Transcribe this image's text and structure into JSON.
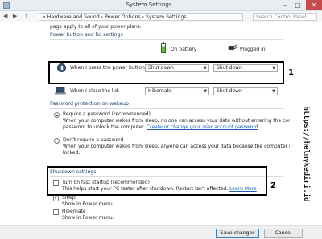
{
  "window": {
    "title": "System Settings",
    "minimize": "–",
    "maximize": "□",
    "close": "✕"
  },
  "address": {
    "back": "◀",
    "forward": "▶",
    "up": "↑",
    "crumbs": "« Hardware and Sound  ›  Power Options  ›  System Settings",
    "search_placeholder": "Search Control Panel"
  },
  "intro_text": "page apply to all of your power plans.",
  "power_lid": {
    "heading": "Power button and lid settings",
    "col_battery": "On battery",
    "col_plugged": "Plugged in",
    "power_button": {
      "label": "When I press the power button:",
      "on_battery": "Shut down",
      "plugged_in": "Shut down"
    },
    "lid": {
      "label": "When I close the lid:",
      "on_battery": "Hibernate",
      "plugged_in": "Shut down"
    }
  },
  "password": {
    "heading": "Password protection on wakeup",
    "require_label": "Require a password (recommended)",
    "require_desc_1": "When your computer wakes from sleep, no one can access your data without entering the correct",
    "require_desc_2": "password to unlock the computer.",
    "require_link": "Create or change your user account password",
    "no_label": "Don't require a password",
    "no_desc_1": "When your computer wakes from sleep, anyone can access your data because the computer isn't",
    "no_desc_2": "locked."
  },
  "shutdown": {
    "heading": "Shutdown settings",
    "fast_label": "Turn on fast startup (recommended)",
    "fast_desc": "This helps start your PC faster after shutdown. Restart isn't affected.",
    "fast_link": "Learn More",
    "sleep_label": "Sleep",
    "sleep_desc": "Show in Power menu.",
    "hibernate_label": "Hibernate",
    "hibernate_desc": "Show in Power menu."
  },
  "annotations": {
    "num1": "1",
    "num2": "2",
    "watermark": "https://helmykediri.id"
  },
  "footer": {
    "save": "Save changes",
    "cancel": "Cancel"
  }
}
